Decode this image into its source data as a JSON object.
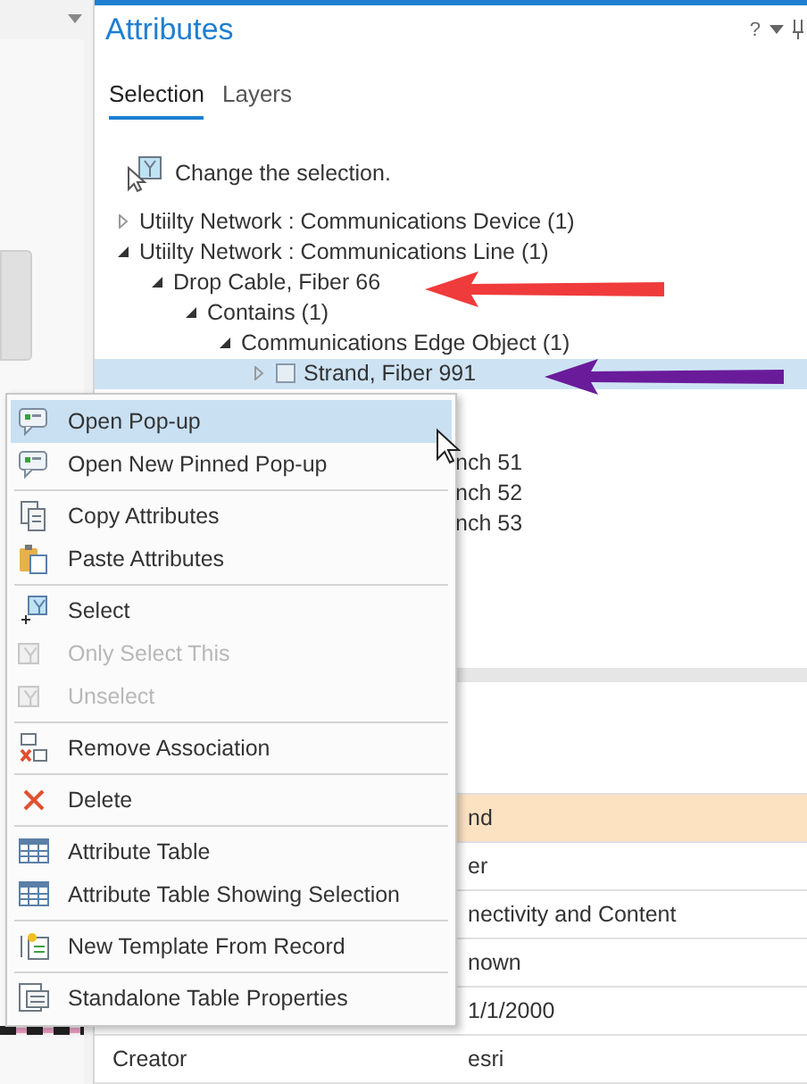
{
  "pane": {
    "title": "Attributes",
    "tool_icons": [
      "?"
    ]
  },
  "tabs": [
    {
      "label": "Selection",
      "selected": true
    },
    {
      "label": "Layers",
      "selected": false
    }
  ],
  "hint": "Change the selection.",
  "tree": [
    {
      "label": "Utiilty Network : Communications Device (1)",
      "expanded": false
    },
    {
      "label": "Utiilty Network : Communications Line (1)",
      "expanded": true,
      "children": [
        {
          "label": "Drop Cable, Fiber 66",
          "expanded": true,
          "children": [
            {
              "label": "Contains (1)",
              "expanded": true,
              "children": [
                {
                  "label": "Communications Edge Object (1)",
                  "expanded": true,
                  "children": [
                    {
                      "label": "Strand, Fiber 991",
                      "expanded": false,
                      "selected": true
                    }
                  ]
                }
              ]
            }
          ]
        }
      ]
    }
  ],
  "covered_tree_rows": [
    "nch 51",
    "nch 52",
    "nch 53"
  ],
  "annotations": [
    {
      "color": "#ef3b3b"
    },
    {
      "color": "#6a1b9a"
    }
  ],
  "table_rows": [
    {
      "value": "nd",
      "highlighted": true
    },
    {
      "value": "er",
      "highlighted": false
    },
    {
      "value": "nectivity and Content",
      "highlighted": false
    },
    {
      "value": "nown",
      "highlighted": false
    },
    {
      "value": "1/1/2000",
      "highlighted": false
    },
    {
      "field": "Creator",
      "value": "esri",
      "highlighted": false
    }
  ],
  "menu": [
    {
      "label": "Open Pop-up",
      "selected": true,
      "disabled": false,
      "separator_before": false
    },
    {
      "label": "Open New Pinned Pop-up",
      "selected": false,
      "disabled": false,
      "separator_before": false
    },
    {
      "label": "Copy Attributes",
      "selected": false,
      "disabled": false,
      "separator_before": true
    },
    {
      "label": "Paste Attributes",
      "selected": false,
      "disabled": false,
      "separator_before": false
    },
    {
      "label": "Select",
      "selected": false,
      "disabled": false,
      "separator_before": true
    },
    {
      "label": "Only Select This",
      "selected": false,
      "disabled": true,
      "separator_before": false
    },
    {
      "label": "Unselect",
      "selected": false,
      "disabled": true,
      "separator_before": false
    },
    {
      "label": "Remove Association",
      "selected": false,
      "disabled": false,
      "separator_before": true
    },
    {
      "label": "Delete",
      "selected": false,
      "disabled": false,
      "separator_before": true
    },
    {
      "label": "Attribute Table",
      "selected": false,
      "disabled": false,
      "separator_before": true
    },
    {
      "label": "Attribute Table Showing Selection",
      "selected": false,
      "disabled": false,
      "separator_before": false
    },
    {
      "label": "New Template From Record",
      "selected": false,
      "disabled": false,
      "separator_before": true
    },
    {
      "label": "Standalone Table Properties",
      "selected": false,
      "disabled": false,
      "separator_before": true
    }
  ]
}
